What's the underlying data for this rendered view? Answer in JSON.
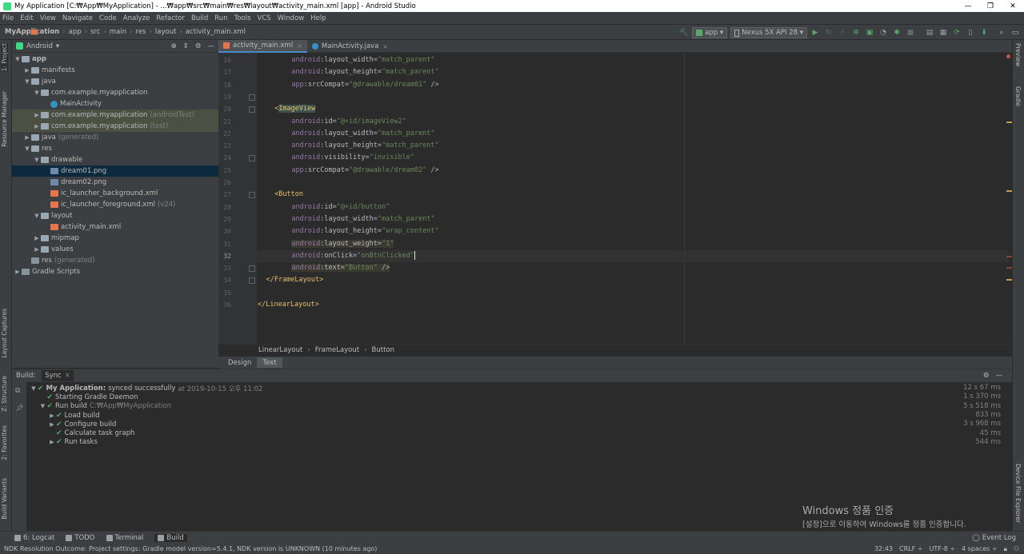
{
  "window": {
    "title": "My Application [C:₩App₩MyApplication] - ...₩app₩src₩main₩res₩layout₩activity_main.xml [app] - Android Studio"
  },
  "menu": [
    "File",
    "Edit",
    "View",
    "Navigate",
    "Code",
    "Analyze",
    "Refactor",
    "Build",
    "Run",
    "Tools",
    "VCS",
    "Window",
    "Help"
  ],
  "breadcrumbs": [
    "MyApplication",
    "app",
    "src",
    "main",
    "res",
    "layout",
    "activity_main.xml"
  ],
  "toolbar": {
    "run_config": "app",
    "device": "Nexus 5X API 28"
  },
  "project": {
    "view": "Android",
    "tree": [
      {
        "label": "app",
        "depth": 0,
        "icon": "folder",
        "arrow": "▼",
        "bold": true
      },
      {
        "label": "manifests",
        "depth": 1,
        "icon": "folder",
        "arrow": "▶"
      },
      {
        "label": "java",
        "depth": 1,
        "icon": "folder",
        "arrow": "▼"
      },
      {
        "label": "com.example.myapplication",
        "depth": 2,
        "icon": "pkg",
        "arrow": "▼"
      },
      {
        "label": "MainActivity",
        "depth": 3,
        "icon": "class",
        "arrow": ""
      },
      {
        "label": "com.example.myapplication",
        "suffix": "(androidTest)",
        "depth": 2,
        "icon": "pkg",
        "arrow": "▶",
        "mod": true
      },
      {
        "label": "com.example.myapplication",
        "suffix": "(test)",
        "depth": 2,
        "icon": "pkg",
        "arrow": "▶",
        "mod": true
      },
      {
        "label": "java",
        "suffix": "(generated)",
        "depth": 1,
        "icon": "folder",
        "arrow": "▶"
      },
      {
        "label": "res",
        "depth": 1,
        "icon": "folder",
        "arrow": "▼"
      },
      {
        "label": "drawable",
        "depth": 2,
        "icon": "folder",
        "arrow": "▼"
      },
      {
        "label": "dream01.png",
        "depth": 3,
        "icon": "png",
        "arrow": "",
        "selected": true
      },
      {
        "label": "dream02.png",
        "depth": 3,
        "icon": "png",
        "arrow": ""
      },
      {
        "label": "ic_launcher_background.xml",
        "depth": 3,
        "icon": "xml",
        "arrow": ""
      },
      {
        "label": "ic_launcher_foreground.xml",
        "suffix": "(v24)",
        "depth": 3,
        "icon": "xml",
        "arrow": ""
      },
      {
        "label": "layout",
        "depth": 2,
        "icon": "folder",
        "arrow": "▼"
      },
      {
        "label": "activity_main.xml",
        "depth": 3,
        "icon": "xml",
        "arrow": ""
      },
      {
        "label": "mipmap",
        "depth": 2,
        "icon": "folder",
        "arrow": "▶"
      },
      {
        "label": "values",
        "depth": 2,
        "icon": "folder",
        "arrow": "▶"
      },
      {
        "label": "res",
        "suffix": "(generated)",
        "depth": 1,
        "icon": "res",
        "arrow": ""
      },
      {
        "label": "Gradle Scripts",
        "depth": 0,
        "icon": "res",
        "arrow": "▶"
      }
    ]
  },
  "editor": {
    "tabs": [
      {
        "label": "activity_main.xml",
        "active": true,
        "icon_color": "#e8754a"
      },
      {
        "label": "MainActivity.java",
        "active": false,
        "icon_color": "#3592c4"
      }
    ],
    "lines": [
      {
        "n": "16",
        "indent": 8,
        "parts": [
          [
            "ns",
            "android"
          ],
          [
            "pn",
            ":"
          ],
          [
            "at",
            "layout_width"
          ],
          [
            "pn",
            "="
          ],
          [
            "st",
            "\"match_parent\""
          ]
        ]
      },
      {
        "n": "17",
        "indent": 8,
        "parts": [
          [
            "ns",
            "android"
          ],
          [
            "pn",
            ":"
          ],
          [
            "at",
            "layout_height"
          ],
          [
            "pn",
            "="
          ],
          [
            "st",
            "\"match_parent\""
          ]
        ]
      },
      {
        "n": "18",
        "indent": 8,
        "parts": [
          [
            "ns",
            "app"
          ],
          [
            "pn",
            ":"
          ],
          [
            "at",
            "srcCompat"
          ],
          [
            "pn",
            "="
          ],
          [
            "st",
            "\"@drawable/dream01\""
          ],
          [
            "pn",
            " />"
          ]
        ]
      },
      {
        "n": "19",
        "indent": 0,
        "parts": []
      },
      {
        "n": "20",
        "indent": 4,
        "parts": [
          [
            "tg",
            "<"
          ],
          [
            "tagbg",
            "ImageView"
          ]
        ]
      },
      {
        "n": "21",
        "indent": 8,
        "parts": [
          [
            "ns",
            "android"
          ],
          [
            "pn",
            ":"
          ],
          [
            "at",
            "id"
          ],
          [
            "pn",
            "="
          ],
          [
            "st",
            "\"@+id/imageView2\""
          ]
        ]
      },
      {
        "n": "22",
        "indent": 8,
        "parts": [
          [
            "ns",
            "android"
          ],
          [
            "pn",
            ":"
          ],
          [
            "at",
            "layout_width"
          ],
          [
            "pn",
            "="
          ],
          [
            "st",
            "\"match_parent\""
          ]
        ]
      },
      {
        "n": "23",
        "indent": 8,
        "parts": [
          [
            "ns",
            "android"
          ],
          [
            "pn",
            ":"
          ],
          [
            "at",
            "layout_height"
          ],
          [
            "pn",
            "="
          ],
          [
            "st",
            "\"match_parent\""
          ]
        ]
      },
      {
        "n": "24",
        "indent": 8,
        "parts": [
          [
            "ns",
            "android"
          ],
          [
            "pn",
            ":"
          ],
          [
            "at",
            "visibility"
          ],
          [
            "pn",
            "="
          ],
          [
            "st",
            "\"invisible\""
          ]
        ]
      },
      {
        "n": "25",
        "indent": 8,
        "parts": [
          [
            "ns",
            "app"
          ],
          [
            "pn",
            ":"
          ],
          [
            "at",
            "srcCompat"
          ],
          [
            "pn",
            "="
          ],
          [
            "st",
            "\"@drawable/dream02\""
          ],
          [
            "pn",
            " />"
          ]
        ]
      },
      {
        "n": "26",
        "indent": 0,
        "parts": []
      },
      {
        "n": "27",
        "indent": 4,
        "parts": [
          [
            "tg",
            "<Button"
          ]
        ]
      },
      {
        "n": "28",
        "indent": 8,
        "parts": [
          [
            "ns",
            "android"
          ],
          [
            "pn",
            ":"
          ],
          [
            "at",
            "id"
          ],
          [
            "pn",
            "="
          ],
          [
            "st",
            "\"@+id/button\""
          ]
        ]
      },
      {
        "n": "29",
        "indent": 8,
        "parts": [
          [
            "ns",
            "android"
          ],
          [
            "pn",
            ":"
          ],
          [
            "at",
            "layout_width"
          ],
          [
            "pn",
            "="
          ],
          [
            "st",
            "\"match_parent\""
          ]
        ]
      },
      {
        "n": "30",
        "indent": 8,
        "parts": [
          [
            "ns",
            "android"
          ],
          [
            "pn",
            ":"
          ],
          [
            "at",
            "layout_height"
          ],
          [
            "pn",
            "="
          ],
          [
            "st",
            "\"wrap_content\""
          ]
        ]
      },
      {
        "n": "31",
        "indent": 8,
        "hl": true,
        "parts": [
          [
            "ns",
            "android"
          ],
          [
            "pn",
            ":"
          ],
          [
            "at",
            "layout_weight"
          ],
          [
            "pn",
            "="
          ],
          [
            "st",
            "\"1\""
          ]
        ]
      },
      {
        "n": "32",
        "indent": 8,
        "cur": true,
        "parts": [
          [
            "ns",
            "android"
          ],
          [
            "pn",
            ":"
          ],
          [
            "at",
            "onClick"
          ],
          [
            "pn",
            "="
          ],
          [
            "st",
            "\"onBtnClicked\""
          ]
        ]
      },
      {
        "n": "33",
        "indent": 8,
        "hl": true,
        "parts": [
          [
            "ns",
            "android"
          ],
          [
            "pn",
            ":"
          ],
          [
            "at",
            "text"
          ],
          [
            "pn",
            "="
          ],
          [
            "st",
            "\"Button\""
          ],
          [
            "pn",
            " />"
          ]
        ]
      },
      {
        "n": "34",
        "indent": 2,
        "parts": [
          [
            "tg",
            "</FrameLayout>"
          ]
        ]
      },
      {
        "n": "35",
        "indent": 0,
        "parts": []
      },
      {
        "n": "36",
        "indent": 0,
        "parts": [
          [
            "tg",
            "</LinearLayout>"
          ]
        ]
      }
    ],
    "structure_crumbs": [
      "LinearLayout",
      "FrameLayout",
      "Button"
    ],
    "mode_tabs": [
      "Design",
      "Text"
    ],
    "active_mode": "Text"
  },
  "build": {
    "title": "Build:",
    "tab": "Sync",
    "rows": [
      {
        "depth": 0,
        "arrow": "▼",
        "label": "My Application:",
        "bold": true,
        "detail": "synced successfully",
        "meta": "at 2019-10-15 오후 11:02",
        "time": "12 s 67 ms"
      },
      {
        "depth": 1,
        "arrow": "",
        "label": "Starting Gradle Daemon",
        "time": "1 s 370 ms"
      },
      {
        "depth": 1,
        "arrow": "▼",
        "label": "Run build",
        "meta": "C:₩App₩MyApplication",
        "time": "5 s 518 ms"
      },
      {
        "depth": 2,
        "arrow": "▶",
        "label": "Load build",
        "time": "833 ms"
      },
      {
        "depth": 2,
        "arrow": "▶",
        "label": "Configure build",
        "time": "3 s 968 ms"
      },
      {
        "depth": 2,
        "arrow": "",
        "label": "Calculate task graph",
        "time": "45 ms"
      },
      {
        "depth": 2,
        "arrow": "▶",
        "label": "Run tasks",
        "time": "544 ms"
      }
    ]
  },
  "left_strip": [
    "1: Project",
    "Resource Manager",
    "Layout Captures",
    "Z: Structure",
    "2: Favorites",
    "Build Variants"
  ],
  "right_strip": [
    "Preview",
    "Gradle",
    "Device File Explorer"
  ],
  "bottom_tabs": [
    {
      "label": "6: Logcat"
    },
    {
      "label": "TODO"
    },
    {
      "label": "Terminal"
    },
    {
      "label": "Build",
      "active": true
    }
  ],
  "event_log": "Event Log",
  "status": {
    "message": "NDK Resolution Outcome: Project settings: Gradle model version=5.4.1, NDK version is UNKNOWN (10 minutes ago)",
    "position": "32:43",
    "line_sep": "CRLF ÷",
    "encoding": "UTF-8 ÷",
    "indent": "4 spaces ÷"
  },
  "watermark": {
    "line1": "Windows 정품 인증",
    "line2": "[설정]으로 이동하여 Windows를 정품 인증합니다."
  }
}
